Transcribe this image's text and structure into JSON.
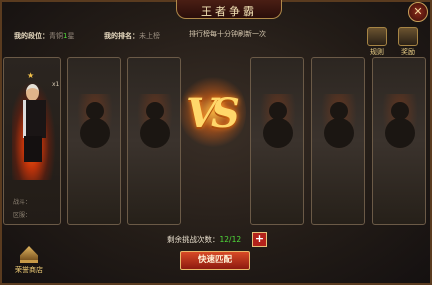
{
  "header": {
    "title": "王者争霸",
    "close_glyph": "✕"
  },
  "info": {
    "rank_label": "我的段位：",
    "rank_value_prefix": "青铜",
    "rank_value_highlight": "1",
    "rank_value_suffix": "星",
    "ranking_label": "我的排名：",
    "ranking_value": "未上榜",
    "refresh_note": "排行榜每十分钟刷新一次"
  },
  "buttons": {
    "rules": "规则",
    "rewards": "奖励",
    "quick_match": "快速匹配",
    "add": "+"
  },
  "player": {
    "stars": "★",
    "multiplier": "x1",
    "stat1_label": "战斗：",
    "stat2_label": "区服："
  },
  "vs_label": "VS",
  "challenges": {
    "label": "剩余挑战次数：",
    "count": "12/12"
  },
  "shop": {
    "label": "荣誉商店"
  }
}
